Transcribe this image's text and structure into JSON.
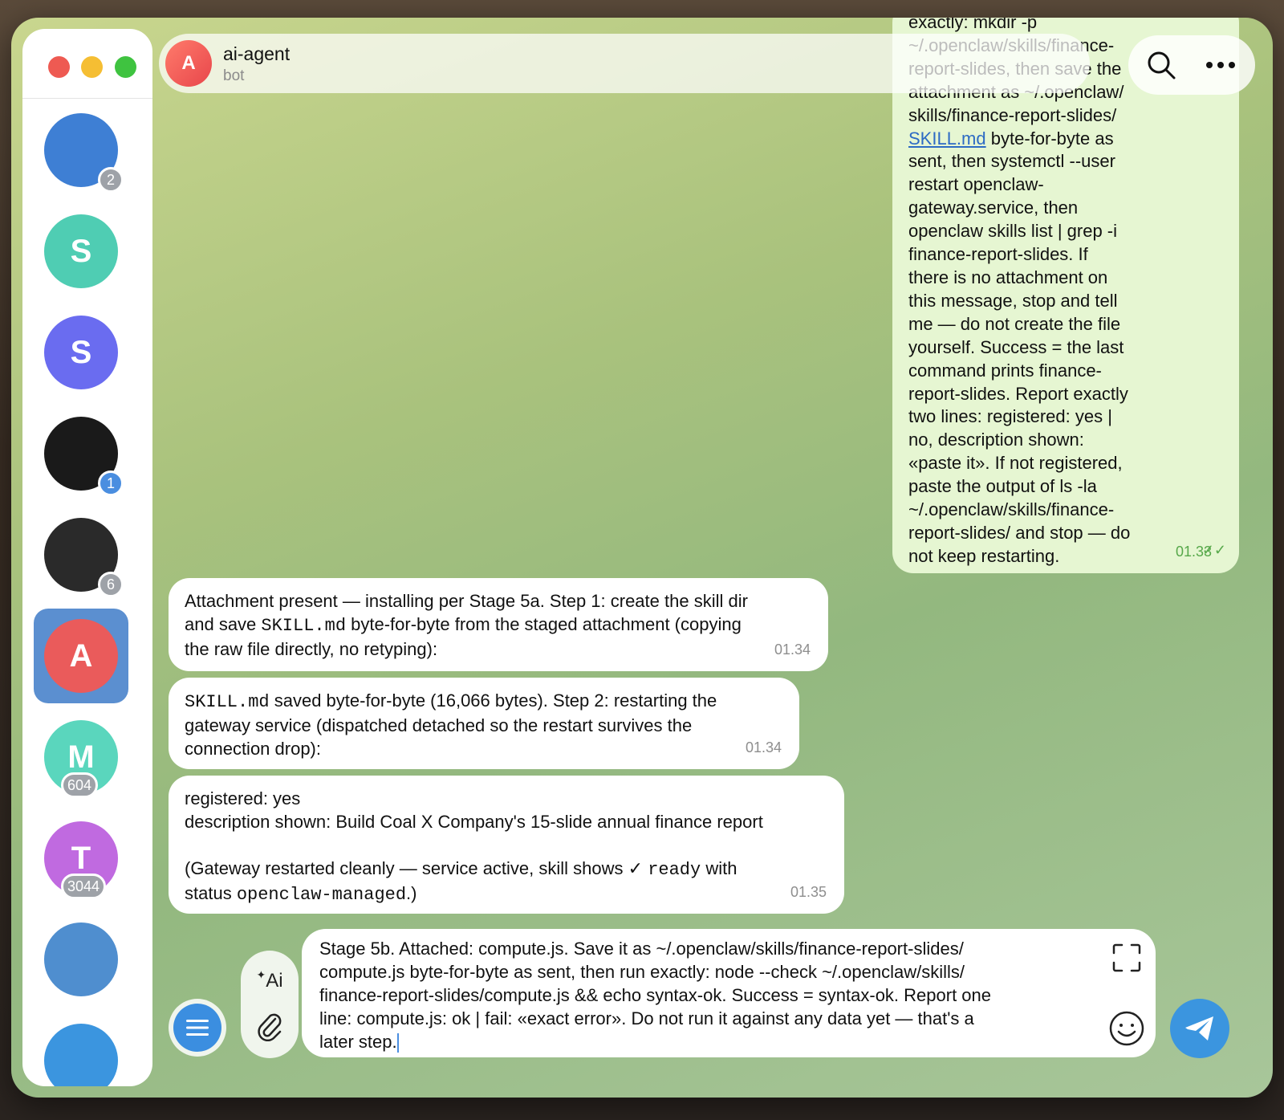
{
  "window": {
    "controls": [
      "close",
      "minimize",
      "maximize"
    ]
  },
  "sidebar": {
    "items": [
      {
        "letter": "",
        "icon": "archive-icon",
        "color": "#3e7fd4",
        "badge": "2"
      },
      {
        "letter": "S",
        "color": "#4fcdb3",
        "badge": ""
      },
      {
        "letter": "S",
        "color": "#6a6cf0",
        "badge": ""
      },
      {
        "letter": "",
        "icon": "lightning-logo-icon",
        "color": "#1a1a1a",
        "badge": "1"
      },
      {
        "letter": "",
        "icon": "fist-image",
        "color": "#2a2a2a",
        "badge": "6"
      },
      {
        "letter": "A",
        "color": "#ea5b5b",
        "badge": "",
        "active": true
      },
      {
        "letter": "M",
        "color": "#5ad6bd",
        "badge": "604"
      },
      {
        "letter": "T",
        "color": "#c06ae0",
        "badge": "3044"
      },
      {
        "letter": "",
        "icon": "character-avatar-image",
        "color": "#4f8ecf",
        "badge": ""
      },
      {
        "letter": "",
        "icon": "telegram-icon",
        "color": "#3b95df",
        "badge": ""
      }
    ]
  },
  "header": {
    "avatar_letter": "A",
    "title": "ai-agent",
    "subtitle": "bot",
    "search_icon": "search-icon",
    "more_icon": "more-icon"
  },
  "messages": {
    "outgoing": {
      "lines": [
        "exactly: mkdir -p",
        "~/.openclaw/skills/finance-",
        "report-slides, then save the",
        "attachment as ~/.openclaw/",
        "skills/finance-report-slides/",
        "byte-for-byte as",
        "sent, then systemctl --user",
        "restart openclaw-",
        "gateway.service, then",
        "openclaw skills list | grep -i",
        "finance-report-slides. If",
        "there is no attachment on",
        "this message, stop and tell",
        "me — do not create the file",
        "yourself. Success = the last",
        "command prints finance-",
        "report-slides. Report exactly",
        "two lines: registered: yes |",
        "no, description shown:",
        "«paste it». If not registered,",
        "paste the output of ls -la",
        "~/.openclaw/skills/finance-",
        "report-slides/ and stop — do",
        "not keep restarting."
      ],
      "link_text": "SKILL.md",
      "time": "01.33",
      "status": "read"
    },
    "incoming": [
      {
        "l1": "Attachment present — installing per Stage 5a. Step 1: create the skill dir",
        "l2a": "and save ",
        "l2code": "SKILL.md",
        "l2b": " byte-for-byte from the staged attachment (copying",
        "l3": "the raw file directly, no retyping):",
        "time": "01.34"
      },
      {
        "l1code": "SKILL.md",
        "l1": " saved byte-for-byte (16,066 bytes). Step 2: restarting the",
        "l2": "gateway service (dispatched detached so the restart survives the",
        "l3": "connection drop):",
        "time": "01.34"
      },
      {
        "l1": "registered: yes",
        "l2": "description shown: Build Coal X Company's 15-slide annual finance report",
        "l4a": "(Gateway restarted cleanly — service active, skill shows ✓ ",
        "l4code": "ready",
        "l4b": " with",
        "l5a": "status ",
        "l5code": "openclaw-managed",
        "l5b": ".)",
        "time": "01.35"
      }
    ]
  },
  "composer": {
    "text_lines": [
      "Stage 5b. Attached: compute.js. Save it as ~/.openclaw/skills/finance-report-slides/",
      "compute.js byte-for-byte as sent, then run exactly: node --check ~/.openclaw/skills/",
      "finance-report-slides/compute.js && echo syntax-ok. Success = syntax-ok. Report one",
      "line: compute.js: ok | fail: «exact error». Do not run it against any data yet — that's a",
      "later step."
    ],
    "ai_label": "Ai",
    "menu_icon": "menu-icon",
    "attach_icon": "paperclip-icon",
    "expand_icon": "expand-icon",
    "emoji_icon": "emoji-icon",
    "send_icon": "send-icon"
  }
}
